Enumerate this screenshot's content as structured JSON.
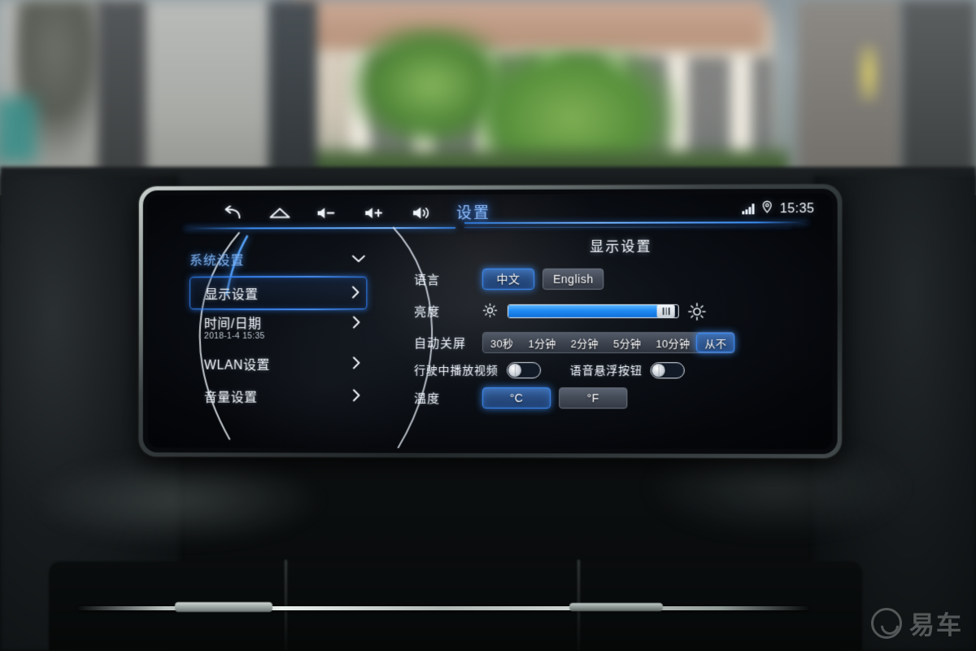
{
  "statusbar": {
    "time": "15:35",
    "signal_icon": "signal-bars-icon",
    "location_icon": "location-pin-icon"
  },
  "navbar": {
    "icons": [
      {
        "name": "back-icon",
        "label": "Back"
      },
      {
        "name": "home-icon",
        "label": "Home"
      },
      {
        "name": "volume-down-icon",
        "label": "Volume Down"
      },
      {
        "name": "volume-up-icon",
        "label": "Volume Up"
      },
      {
        "name": "volume-icon",
        "label": "Volume"
      }
    ]
  },
  "header": {
    "title": "设置"
  },
  "sidebar": {
    "group_label": "系统设置",
    "expand_icon": "chevron-down-icon",
    "items": [
      {
        "label": "显示设置",
        "sub": "",
        "selected": true
      },
      {
        "label": "时间/日期",
        "sub": "2018-1-4 15:35",
        "selected": false
      },
      {
        "label": "WLAN设置",
        "sub": "",
        "selected": false
      },
      {
        "label": "音量设置",
        "sub": "",
        "selected": false
      }
    ]
  },
  "panel": {
    "title": "显示设置",
    "language": {
      "label": "语言",
      "options": [
        {
          "label": "中文",
          "selected": true
        },
        {
          "label": "English",
          "selected": false
        }
      ]
    },
    "brightness": {
      "label": "亮度",
      "low_icon": "sun-small-icon",
      "high_icon": "sun-large-icon",
      "value_percent": 93
    },
    "auto_off": {
      "label": "自动关屏",
      "options": [
        {
          "label": "30秒",
          "selected": false
        },
        {
          "label": "1分钟",
          "selected": false
        },
        {
          "label": "2分钟",
          "selected": false
        },
        {
          "label": "5分钟",
          "selected": false
        },
        {
          "label": "10分钟",
          "selected": false
        },
        {
          "label": "从不",
          "selected": true
        }
      ]
    },
    "toggles": [
      {
        "label": "行驶中播放视频",
        "on": false
      },
      {
        "label": "语音悬浮按钮",
        "on": false
      }
    ],
    "temperature": {
      "label": "温度",
      "options": [
        {
          "label": "°C",
          "selected": true
        },
        {
          "label": "°F",
          "selected": false
        }
      ]
    }
  },
  "watermark": {
    "text": "易车"
  },
  "colors": {
    "accent_blue": "#3f90ff",
    "title_blue": "#8fc0ff",
    "screen_bg": "#0c1016",
    "button_gray": "#454c59"
  }
}
